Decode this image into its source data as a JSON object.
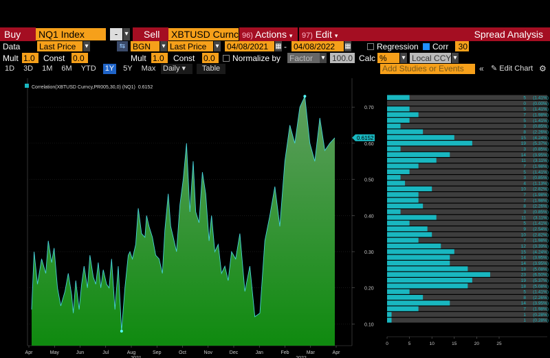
{
  "toolbar": {
    "buy_label": "Buy",
    "buy_ticker": "NQ1 Index",
    "minus_label": "-",
    "sell_label": "Sell",
    "sell_ticker": "XBTUSD Curncy",
    "actions_num": "96)",
    "actions_label": "Actions",
    "edit_num": "97)",
    "edit_label": "Edit",
    "title": "Spread Analysis"
  },
  "row2": {
    "data_label": "Data",
    "price1": "Last Price",
    "source": "BGN",
    "price2": "Last Price",
    "start_date": "04/08/2021",
    "end_date": "04/08/2022",
    "regression_label": "Regression",
    "corr_label": "Corr",
    "corr_period": "30"
  },
  "row3": {
    "mult_label": "Mult",
    "mult1": "1.0",
    "const_label": "Const",
    "const1": "0.0",
    "mult2": "1.0",
    "const2": "0.0",
    "normalize_label": "Normalize by",
    "factor_label": "Factor",
    "factor_value": "100.0",
    "calc_label": "Calc",
    "calc_value": "%",
    "ccy_label": "Local CCY"
  },
  "row4": {
    "periods": [
      "1D",
      "3D",
      "1M",
      "6M",
      "YTD",
      "1Y",
      "5Y",
      "Max"
    ],
    "selected_period": "1Y",
    "frequency": "Daily",
    "table_label": "Table",
    "studies_placeholder": "Add Studies or Events",
    "edit_chart_label": "Edit Chart"
  },
  "colors": {
    "accent_orange": "#f6a01a",
    "brand_red": "#a40e22",
    "series_green": "#2e8b2e",
    "hist_cyan": "#19b7c0",
    "hist_gray": "#4a4a4a"
  },
  "chart_data": [
    {
      "type": "area",
      "legend": "Correlation(XBTUSD Curncy,PR005,30,0) (NQ1)",
      "legend_value": "0.6152",
      "last_value_label": "0.6152",
      "y_ticks": [
        "0.10",
        "0.20",
        "0.30",
        "0.40",
        "0.50",
        "0.60",
        "0.70"
      ],
      "ylim": [
        0.04,
        0.78
      ],
      "x_months": [
        "Apr",
        "May",
        "Jun",
        "Jul",
        "Aug",
        "Sep",
        "Oct",
        "Nov",
        "Dec",
        "Jan",
        "Feb",
        "Mar",
        "Apr"
      ],
      "x_years": [
        "2021",
        "2022"
      ],
      "x": [
        0,
        3,
        7,
        12,
        17,
        20,
        24,
        27,
        31,
        35,
        40,
        44,
        48,
        50,
        53,
        57,
        60,
        63,
        67,
        70,
        74,
        77,
        80,
        83,
        86,
        90,
        93,
        96,
        100,
        104,
        108,
        112,
        116,
        118,
        121,
        125,
        128,
        132,
        136,
        138,
        141,
        145,
        149,
        153,
        157,
        160,
        164,
        167,
        170,
        174,
        178,
        182,
        186,
        190,
        194,
        197,
        201,
        205,
        209,
        213,
        216,
        220,
        224,
        228,
        232,
        236,
        240,
        245,
        250,
        256,
        262,
        268,
        274,
        280,
        286,
        292,
        298,
        304,
        310,
        316,
        322,
        328,
        334,
        340,
        346,
        352,
        358,
        364
      ],
      "y": [
        0.14,
        0.3,
        0.21,
        0.28,
        0.24,
        0.33,
        0.27,
        0.31,
        0.2,
        0.15,
        0.19,
        0.24,
        0.18,
        0.13,
        0.22,
        0.14,
        0.21,
        0.26,
        0.2,
        0.29,
        0.23,
        0.21,
        0.27,
        0.2,
        0.25,
        0.21,
        0.2,
        0.28,
        0.14,
        0.26,
        0.08,
        0.2,
        0.29,
        0.3,
        0.28,
        0.32,
        0.42,
        0.35,
        0.34,
        0.4,
        0.37,
        0.34,
        0.29,
        0.28,
        0.24,
        0.36,
        0.46,
        0.37,
        0.34,
        0.3,
        0.43,
        0.5,
        0.6,
        0.41,
        0.55,
        0.41,
        0.38,
        0.52,
        0.46,
        0.33,
        0.4,
        0.3,
        0.32,
        0.24,
        0.26,
        0.22,
        0.3,
        0.28,
        0.35,
        0.19,
        0.26,
        0.12,
        0.13,
        0.33,
        0.4,
        0.48,
        0.37,
        0.55,
        0.65,
        0.6,
        0.7,
        0.73,
        0.6,
        0.55,
        0.67,
        0.58,
        0.6,
        0.6152
      ],
      "x_max": 364
    },
    {
      "type": "bar",
      "orientation": "horizontal",
      "x_ticks": [
        "0",
        "5",
        "10",
        "15",
        "20",
        "25"
      ],
      "xlim": [
        0,
        25
      ],
      "values": [
        5,
        0,
        5,
        7,
        5,
        3,
        8,
        15,
        19,
        3,
        14,
        11,
        7,
        5,
        3,
        4,
        10,
        7,
        7,
        8,
        3,
        11,
        5,
        9,
        10,
        7,
        12,
        15,
        14,
        14,
        18,
        23,
        19,
        18,
        5,
        8,
        14,
        7,
        1,
        1
      ],
      "labels": [
        "(1.41%)",
        "(0.00%)",
        "(1.41%)",
        "(1.98%)",
        "(1.41%)",
        "(0.85%)",
        "(2.26%)",
        "(4.24%)",
        "(5.37%)",
        "(0.85%)",
        "(3.95%)",
        "(3.11%)",
        "(1.98%)",
        "(1.41%)",
        "(0.85%)",
        "(1.13%)",
        "(2.82%)",
        "(1.98%)",
        "(1.98%)",
        "(2.26%)",
        "(0.85%)",
        "(3.11%)",
        "(1.41%)",
        "(2.54%)",
        "(2.82%)",
        "(1.98%)",
        "(3.39%)",
        "(4.24%)",
        "(3.95%)",
        "(3.95%)",
        "(5.08%)",
        "(6.50%)",
        "(5.37%)",
        "(5.08%)",
        "(1.41%)",
        "(2.26%)",
        "(3.95%)",
        "(1.98%)",
        "(0.28%)",
        "(0.28%)"
      ]
    }
  ]
}
